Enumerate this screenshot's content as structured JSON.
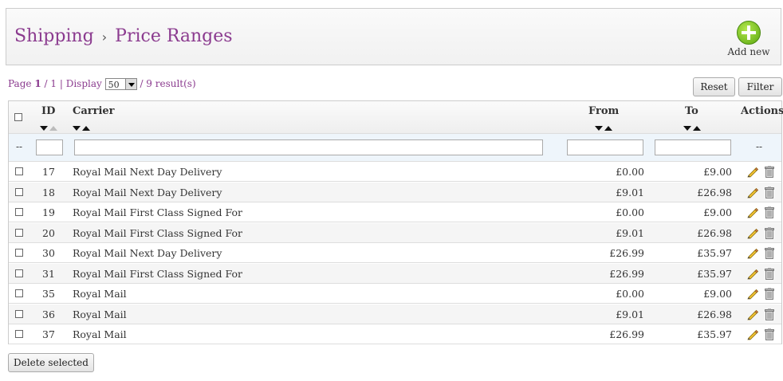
{
  "header": {
    "breadcrumb_parent": "Shipping",
    "breadcrumb_separator": "›",
    "breadcrumb_current": "Price Ranges",
    "add_new_label": "Add new"
  },
  "paging": {
    "page_prefix": "Page",
    "page_current": "1",
    "page_slash": "/",
    "page_total": "1",
    "display_label": "| Display",
    "display_value": "50",
    "results_text": "/ 9 result(s)"
  },
  "buttons": {
    "reset": "Reset",
    "filter": "Filter",
    "delete_selected": "Delete selected"
  },
  "table": {
    "columns": {
      "id": "ID",
      "carrier": "Carrier",
      "from": "From",
      "to": "To",
      "actions": "Actions"
    },
    "filter_placeholder_left": "--",
    "filter_placeholder_right": "--",
    "rows": [
      {
        "id": "17",
        "carrier": "Royal Mail Next Day Delivery",
        "from": "£0.00",
        "to": "£9.00"
      },
      {
        "id": "18",
        "carrier": "Royal Mail Next Day Delivery",
        "from": "£9.01",
        "to": "£26.98"
      },
      {
        "id": "19",
        "carrier": "Royal Mail First Class Signed For",
        "from": "£0.00",
        "to": "£9.00"
      },
      {
        "id": "20",
        "carrier": "Royal Mail First Class Signed For",
        "from": "£9.01",
        "to": "£26.98"
      },
      {
        "id": "30",
        "carrier": "Royal Mail Next Day Delivery",
        "from": "£26.99",
        "to": "£35.97"
      },
      {
        "id": "31",
        "carrier": "Royal Mail First Class Signed For",
        "from": "£26.99",
        "to": "£35.97"
      },
      {
        "id": "35",
        "carrier": "Royal Mail",
        "from": "£0.00",
        "to": "£9.00"
      },
      {
        "id": "36",
        "carrier": "Royal Mail",
        "from": "£9.01",
        "to": "£26.98"
      },
      {
        "id": "37",
        "carrier": "Royal Mail",
        "from": "£26.99",
        "to": "£35.97"
      }
    ]
  },
  "icons": {
    "add": "plus-circle-icon",
    "edit": "pencil-icon",
    "delete": "trash-icon"
  },
  "colors": {
    "accent": "#8b3b8f",
    "add_green": "#5aa70e"
  }
}
